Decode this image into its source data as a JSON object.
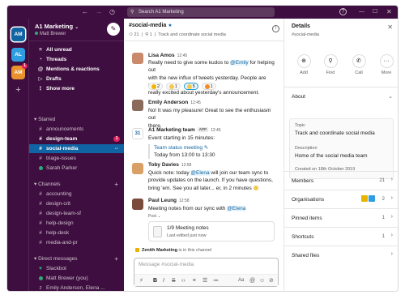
{
  "search": {
    "placeholder": "Search A1 Marketing"
  },
  "topbar": {
    "back_icon": "arrow-left-icon",
    "forward_icon": "arrow-right-icon",
    "history_icon": "clock-icon",
    "help_icon": "help-icon"
  },
  "rail": {
    "workspaces": [
      {
        "initials": "AM",
        "color": "#1164a3",
        "active": true
      },
      {
        "initials": "AL",
        "color": "#2d9ee0"
      },
      {
        "initials": "AM",
        "color": "#e8912d",
        "badge": "1"
      }
    ],
    "add": "+"
  },
  "workspace": {
    "name": "A1 Marketing",
    "user": "Matt Brewer"
  },
  "sidebar": {
    "top": [
      {
        "label": "All unread",
        "icon": "≡"
      },
      {
        "label": "Threads",
        "icon": "◔"
      },
      {
        "label": "Mentions & reactions",
        "icon": "@"
      },
      {
        "label": "Drafts",
        "icon": "▷"
      },
      {
        "label": "Show more",
        "icon": "⋮"
      }
    ],
    "starred_title": "Starred",
    "starred": [
      {
        "label": "announcements",
        "prefix": "#"
      },
      {
        "label": "design-team",
        "prefix": "#",
        "badge": "1"
      },
      {
        "label": "social-media",
        "prefix": "#"
      },
      {
        "label": "triage-issues",
        "prefix": "#"
      },
      {
        "label": "Sarah Parker",
        "prefix": "dot"
      }
    ],
    "channels_title": "Channels",
    "channels": [
      {
        "label": "accounting",
        "prefix": "#"
      },
      {
        "label": "design-crit",
        "prefix": "#"
      },
      {
        "label": "design-team-sf",
        "prefix": "#"
      },
      {
        "label": "help-design",
        "prefix": "#"
      },
      {
        "label": "help-desk",
        "prefix": "#"
      },
      {
        "label": "media-and-pr",
        "prefix": "#"
      }
    ],
    "dm_title": "Direct messages",
    "dms": [
      {
        "label": "Slackbot",
        "prefix": "♥"
      },
      {
        "label": "Matt Brewer (you)",
        "prefix": "dot"
      },
      {
        "label": "Emily Anderson, Elena ...",
        "prefix": "2"
      }
    ]
  },
  "channel": {
    "name": "#social-media",
    "members": "21",
    "pins": "1",
    "topic": "Track and coordinate social media"
  },
  "messages": [
    {
      "author": "Lisa Amos",
      "time": "12:45",
      "pre1": "Really need to give some kudos to ",
      "mention": "@Emily",
      "post1": " for helping out",
      "line2": "with the new influx of tweets yesterday. People are really,",
      "line3": "really excited about yesterday's announcement.",
      "reactions": [
        {
          "count": "2"
        },
        {
          "count": "1"
        },
        {
          "count": "5"
        },
        {
          "count": "1"
        }
      ]
    },
    {
      "author": "Emily Anderson",
      "time": "12:45",
      "line1": "No! It was my pleasure! Great to see the enthusiasm out",
      "line2": "there."
    },
    {
      "author": "A1 Marketing team",
      "app": "APP",
      "time": "12:45",
      "line1": "Event starting in 15 minutes:",
      "event_title": "Team status meeting",
      "event_time": "Today from 13:00 to 13:30",
      "cal_day": "31"
    },
    {
      "author": "Toby Davies",
      "time": "12:58",
      "pre1": "Quick note: today ",
      "mention": "@Elena",
      "post1": " will join our team sync to",
      "line2": "provide updates on the launch. If you have questions,",
      "line3": "bring 'em. See you all later... er, in 2 minutes"
    },
    {
      "author": "Paul Leung",
      "time": "12:58",
      "pre1": "Meeting notes from our sync with ",
      "mention": "@Elena",
      "file_type": "Post",
      "file_title": "1/9 Meeting notes",
      "file_sub": "Last edited just now"
    }
  ],
  "zenith": {
    "name": "Zenith Marketing",
    "suffix": " is in this channel"
  },
  "composer": {
    "placeholder": "Message #social-media"
  },
  "details": {
    "title": "Details",
    "subtitle": "#social-media",
    "actions": [
      {
        "label": "Add"
      },
      {
        "label": "Find"
      },
      {
        "label": "Call"
      },
      {
        "label": "More"
      }
    ],
    "about_title": "About",
    "topic_label": "Topic",
    "topic_value": "Track and coordinate social media",
    "desc_label": "Description",
    "desc_value": "Home of the social media team",
    "created": "Created on 18th October 2019",
    "members": {
      "label": "Members",
      "count": "21"
    },
    "organisations": {
      "label": "Organisations",
      "count": "2"
    },
    "pinned": {
      "label": "Pinned items",
      "count": "1"
    },
    "shortcuts": {
      "label": "Shortcuts",
      "count": "1"
    },
    "shared_files": {
      "label": "Shared files"
    }
  }
}
